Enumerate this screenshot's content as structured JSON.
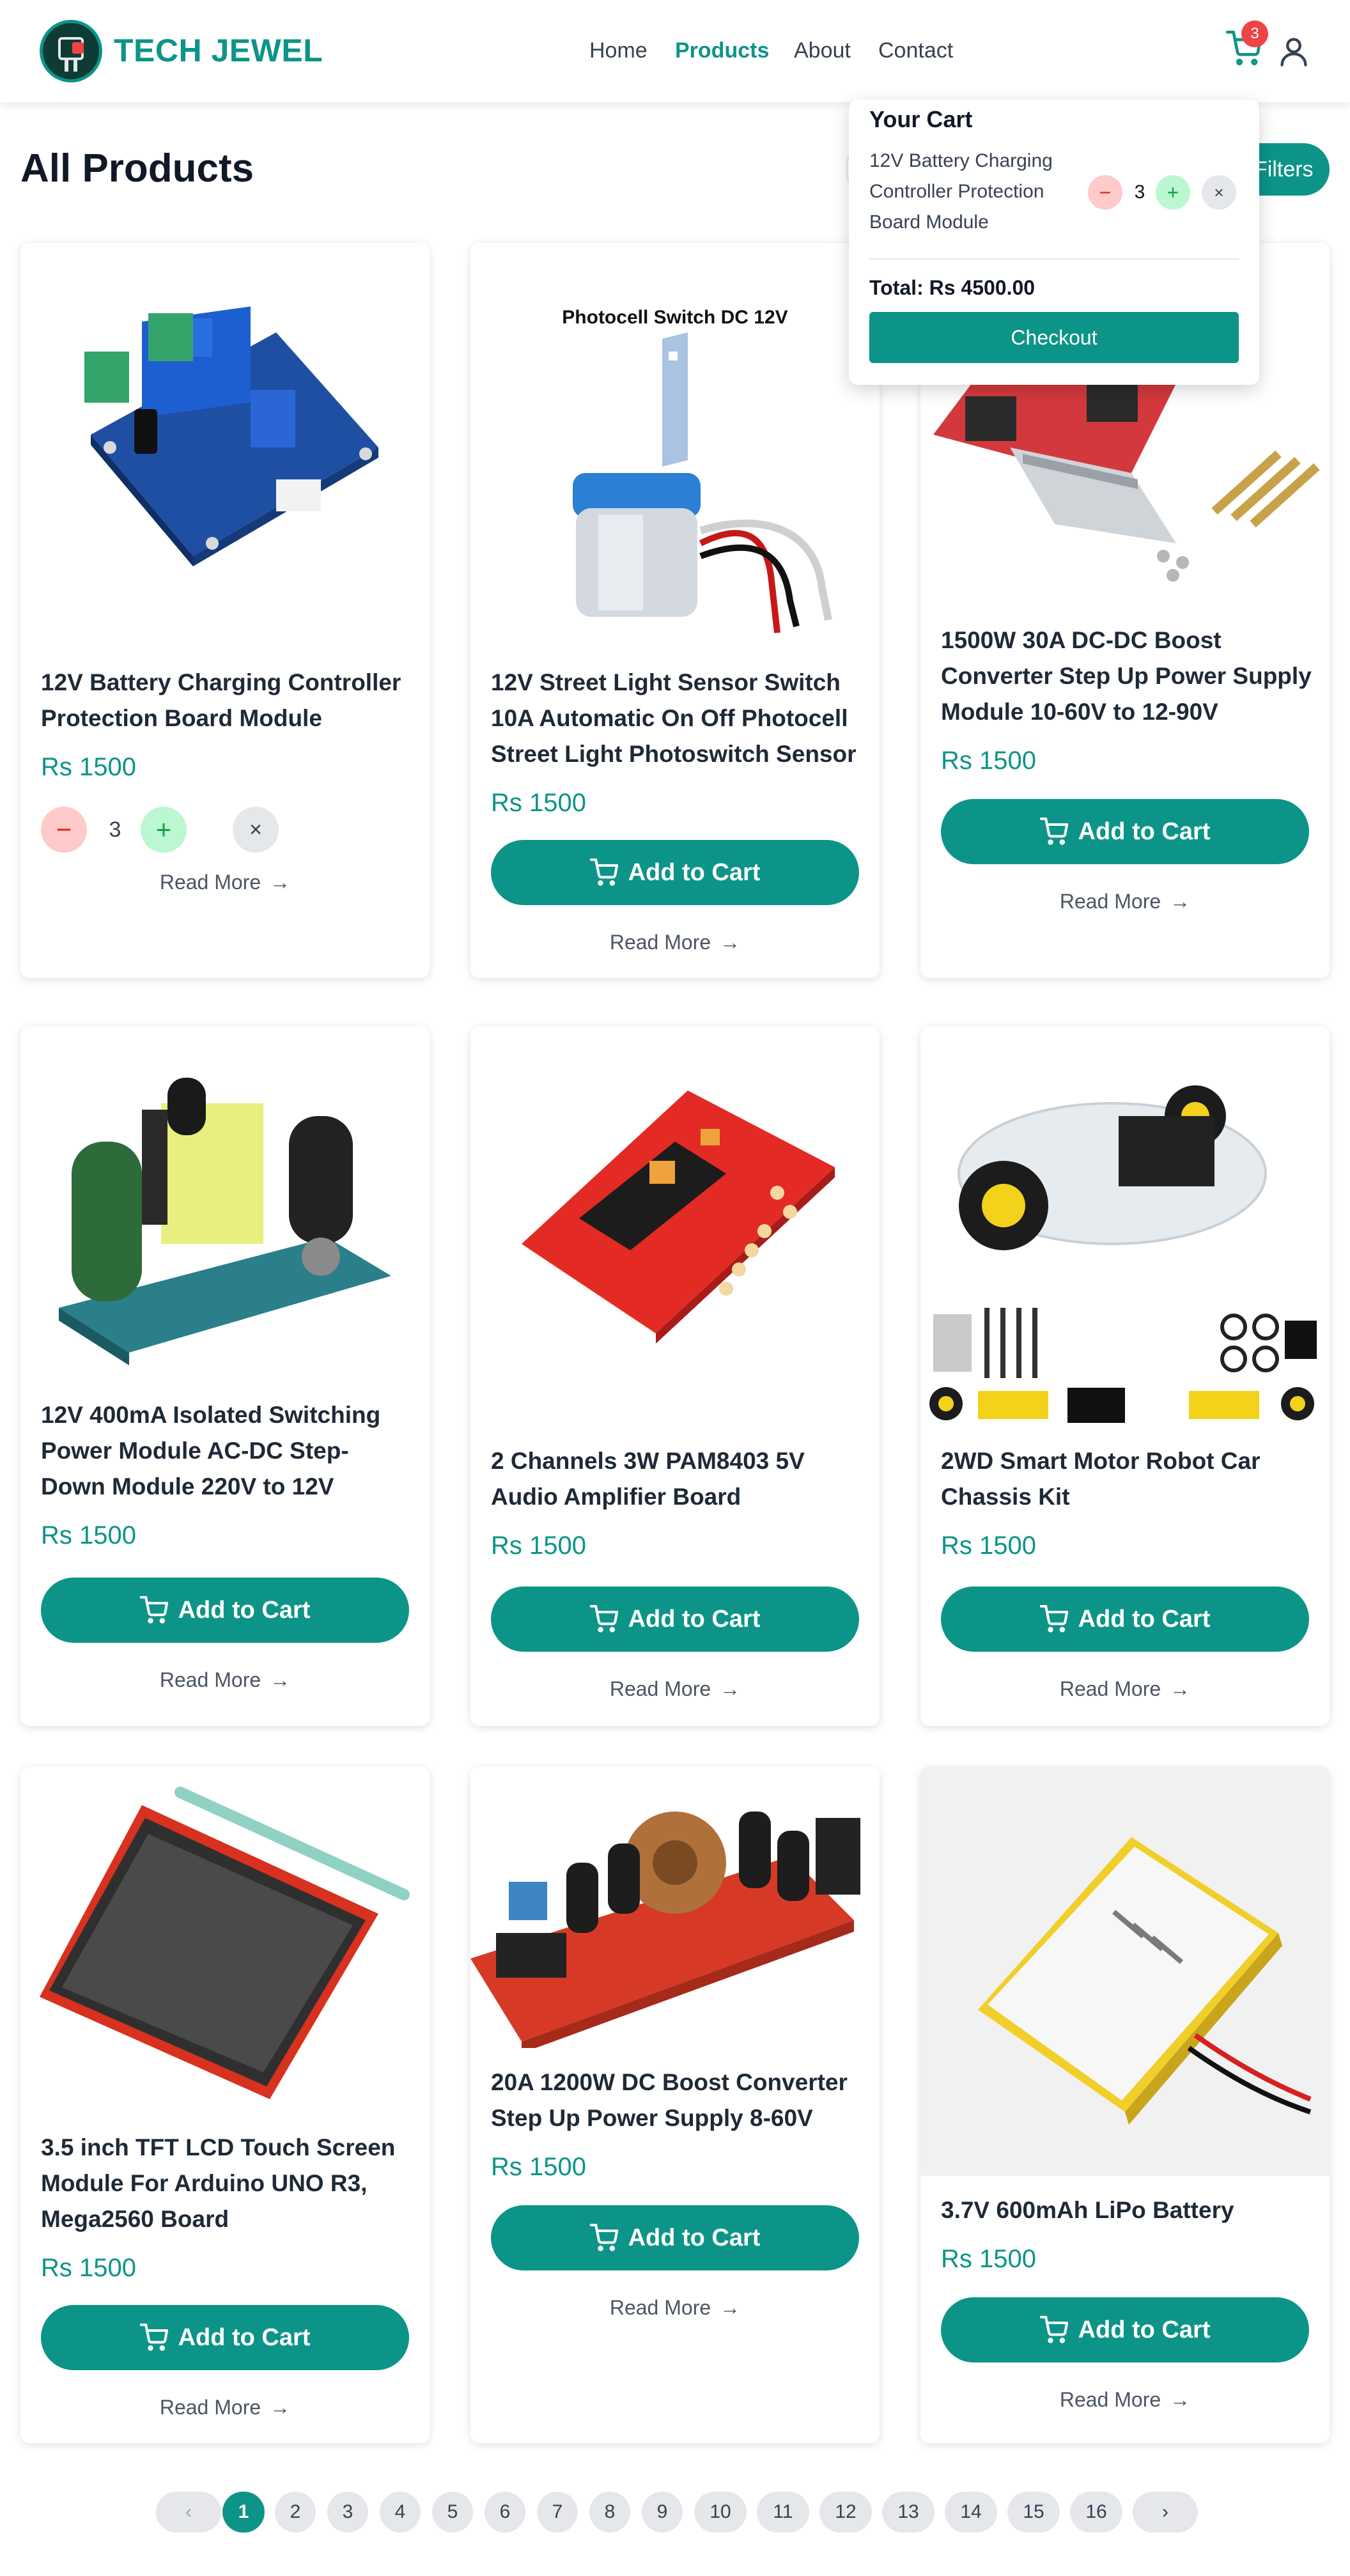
{
  "brand": {
    "name": "TECH JEWEL"
  },
  "nav": [
    {
      "label": "Home",
      "active": false
    },
    {
      "label": "Products",
      "active": true
    },
    {
      "label": "About",
      "active": false
    },
    {
      "label": "Contact",
      "active": false
    }
  ],
  "cart_count": "3",
  "page": {
    "title": "All Products",
    "filters_label": "Filters"
  },
  "cart_popup": {
    "title": "Your Cart",
    "item_name": "12V Battery Charging Controller Protection Board Module",
    "item_qty": "3",
    "total": "Total: Rs 4500.00",
    "checkout_label": "Checkout"
  },
  "labels": {
    "add_to_cart": "Add to Cart",
    "read_more": "Read More"
  },
  "products": [
    {
      "title": "12V Battery Charging Controller Protection Board Module",
      "price": "Rs 1500",
      "qty": "3",
      "image_caption": ""
    },
    {
      "title": "12V Street Light Sensor Switch 10A Automatic On Off Photocell Street Light Photoswitch Sensor",
      "price": "Rs 1500",
      "image_caption": "Photocell Switch DC 12V"
    },
    {
      "title": "1500W 30A DC-DC Boost Converter Step Up Power Supply Module 10-60V to 12-90V",
      "price": "Rs 1500",
      "image_caption": ""
    },
    {
      "title": "12V 400mA Isolated Switching Power Module AC-DC Step-Down Module 220V to 12V",
      "price": "Rs 1500",
      "image_caption": ""
    },
    {
      "title": "2 Channels 3W PAM8403 5V Audio Amplifier Board",
      "price": "Rs 1500",
      "image_caption": ""
    },
    {
      "title": "2WD Smart Motor Robot Car Chassis Kit",
      "price": "Rs 1500",
      "image_caption": ""
    },
    {
      "title": "3.5 inch TFT LCD Touch Screen Module For Arduino UNO R3, Mega2560 Board",
      "price": "Rs 1500",
      "image_caption": ""
    },
    {
      "title": "20A 1200W DC Boost Converter Step Up Power Supply 8-60V",
      "price": "Rs 1500",
      "image_caption": ""
    },
    {
      "title": "3.7V 600mAh LiPo Battery",
      "price": "Rs 1500",
      "image_caption": ""
    }
  ],
  "pagination": {
    "prev": "‹",
    "next": "›",
    "pages": [
      "1",
      "2",
      "3",
      "4",
      "5",
      "6",
      "7",
      "8",
      "9",
      "10",
      "11",
      "12",
      "13",
      "14",
      "15",
      "16"
    ],
    "current": "1"
  },
  "colors": {
    "accent": "#0d9488",
    "badge": "#ef4444",
    "minus": "#fecaca",
    "plus": "#bbf7d0"
  }
}
